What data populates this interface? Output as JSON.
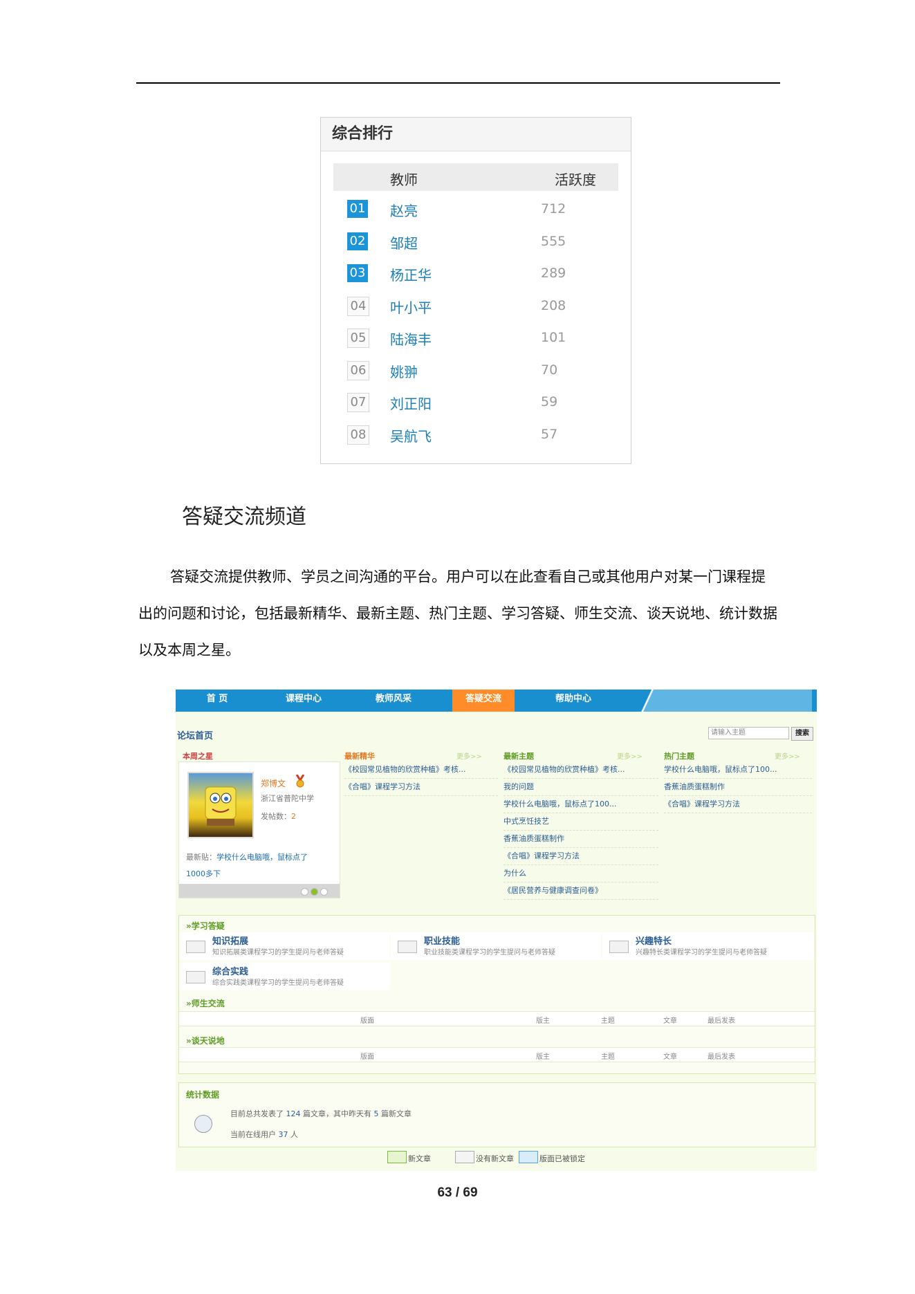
{
  "ranking": {
    "title": "综合排行",
    "col_teacher": "教师",
    "col_activity": "活跃度",
    "rows": [
      {
        "rank": "01",
        "name": "赵亮",
        "score": "712"
      },
      {
        "rank": "02",
        "name": "邹超",
        "score": "555"
      },
      {
        "rank": "03",
        "name": "杨正华",
        "score": "289"
      },
      {
        "rank": "04",
        "name": "叶小平",
        "score": "208"
      },
      {
        "rank": "05",
        "name": "陆海丰",
        "score": "101"
      },
      {
        "rank": "06",
        "name": "姚翀",
        "score": "70"
      },
      {
        "rank": "07",
        "name": "刘正阳",
        "score": "59"
      },
      {
        "rank": "08",
        "name": "吴航飞",
        "score": "57"
      }
    ]
  },
  "section_heading": "答疑交流频道",
  "paragraph": "答疑交流提供教师、学员之间沟通的平台。用户可以在此查看自己或其他用户对某一门课程提出的问题和讨论，包括最新精华、最新主题、热门主题、学习答疑、师生交流、谈天说地、统计数据以及本周之星。",
  "forum": {
    "nav": [
      "首  页",
      "课程中心",
      "教师风采",
      "答疑交流",
      "帮助中心"
    ],
    "home_label": "论坛首页",
    "search_placeholder": "请输入主题",
    "search_button": "搜索",
    "star": {
      "label": "本周之星",
      "name": "郑博文",
      "school": "浙江省普陀中学",
      "posts_label": "发帖数：",
      "posts_value": "2",
      "latest_label": "最新贴：",
      "latest_text": "学校什么电脑哦，鼠标点了1000多下"
    },
    "more": "更多>>",
    "essence": {
      "label": "最新精华",
      "items": [
        "《校园常见植物的欣赏种植》考核...",
        "《合唱》课程学习方法"
      ]
    },
    "newest": {
      "label": "最新主题",
      "items": [
        "《校园常见植物的欣赏种植》考核...",
        "我的问题",
        "学校什么电脑哦，鼠标点了100...",
        "中式烹饪技艺",
        "香蕉油质蛋糕制作",
        "《合唱》课程学习方法",
        "为什么",
        "《居民营养与健康调查问卷》"
      ]
    },
    "hot": {
      "label": "热门主题",
      "items": [
        "学校什么电脑哦，鼠标点了100...",
        "香蕉油质蛋糕制作",
        "《合唱》课程学习方法"
      ]
    },
    "study": {
      "label": "»学习答疑",
      "cats": [
        {
          "title": "知识拓展",
          "desc": "知识拓展类课程学习的学生提问与老师答疑"
        },
        {
          "title": "职业技能",
          "desc": "职业技能类课程学习的学生提问与老师答疑"
        },
        {
          "title": "兴趣特长",
          "desc": "兴趣特长类课程学习的学生提问与老师答疑"
        },
        {
          "title": "综合实践",
          "desc": "综合实践类课程学习的学生提问与老师答疑"
        }
      ]
    },
    "teacher_student": {
      "label": "»师生交流"
    },
    "chat": {
      "label": "»谈天说地"
    },
    "columns": {
      "board": "版面",
      "moderator": "版主",
      "topics": "主题",
      "posts": "文章",
      "last": "最后发表"
    },
    "stats": {
      "label": "统计数据",
      "line1_a": "目前总共发表了",
      "line1_total": "124",
      "line1_b": "篇文章，其中昨天有",
      "line1_yesterday": "5",
      "line1_c": "篇新文章",
      "line2_a": "当前在线用户",
      "line2_online": "37",
      "line2_b": "人"
    },
    "legend": {
      "new": "新文章",
      "none": "没有新文章",
      "locked": "版面已被锁定"
    }
  },
  "page_number": "63 / 69"
}
